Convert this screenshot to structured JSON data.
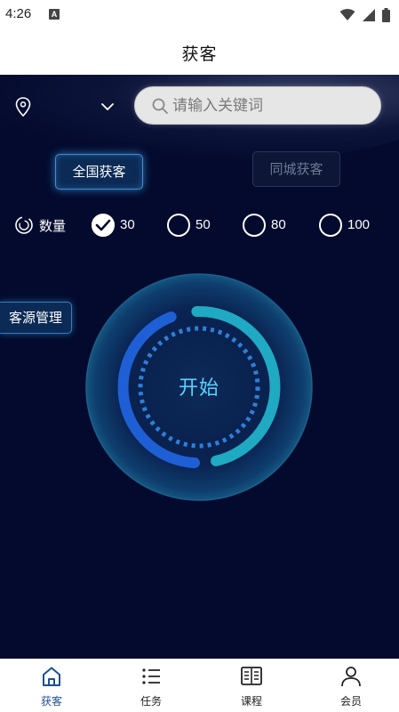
{
  "status_bar": {
    "time": "4:26",
    "notification_badge": "A"
  },
  "header": {
    "title": "获客"
  },
  "top": {
    "search_placeholder": "请输入关键词"
  },
  "tabs": [
    {
      "label": "全国获客",
      "active": true
    },
    {
      "label": "同城获客",
      "active": false
    }
  ],
  "quantity": {
    "label": "数量",
    "options": [
      {
        "value": "30",
        "selected": true
      },
      {
        "value": "50",
        "selected": false
      },
      {
        "value": "80",
        "selected": false
      },
      {
        "value": "100",
        "selected": false
      }
    ]
  },
  "side_button": {
    "label": "客源管理"
  },
  "start_button": {
    "label": "开始"
  },
  "bottom_nav": [
    {
      "label": "获客",
      "icon": "home-icon",
      "active": true
    },
    {
      "label": "任务",
      "icon": "list-icon",
      "active": false
    },
    {
      "label": "课程",
      "icon": "book-icon",
      "active": false
    },
    {
      "label": "会员",
      "icon": "person-icon",
      "active": false
    }
  ],
  "colors": {
    "background": "#030a2e",
    "accent_cyan": "#58d4ff",
    "arc_blue": "#1f5fd6",
    "arc_teal": "#1fa9c2",
    "nav_active": "#1c4f8f"
  }
}
